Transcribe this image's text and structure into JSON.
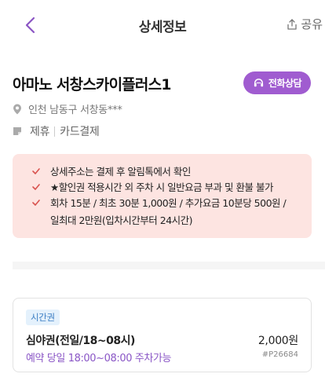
{
  "header": {
    "title": "상세정보",
    "share_label": "공유"
  },
  "place": {
    "name": "아마노 서창스카이플러스1",
    "call_button_label": "전화상담",
    "address": "인천 남동구 서창동***",
    "tags": [
      "제휴",
      "카드결제"
    ]
  },
  "notice": {
    "items": [
      "상세주소는 결제 후 알림톡에서 확인",
      "★할인권 적용시간 외 주차 시 일반요금 부과 및 환불 불가",
      "회차 15분 / 최초 30분 1,000원 / 추가요금 10분당 500원 /"
    ],
    "item3_continued": "일최대 2만원(입차시간부터 24시간)"
  },
  "ticket": {
    "badge": "시간권",
    "name": "심야권(전일/18~08시)",
    "price": "2,000원",
    "availability": "예약 당일 18:00~08:00 주차가능",
    "code": "#P26684"
  },
  "colors": {
    "accent": "#a05cd0",
    "notice_bg": "#fde4e1",
    "check": "#d9534f",
    "badge_bg": "#e4f1fc",
    "badge_text": "#3d7fc4"
  }
}
